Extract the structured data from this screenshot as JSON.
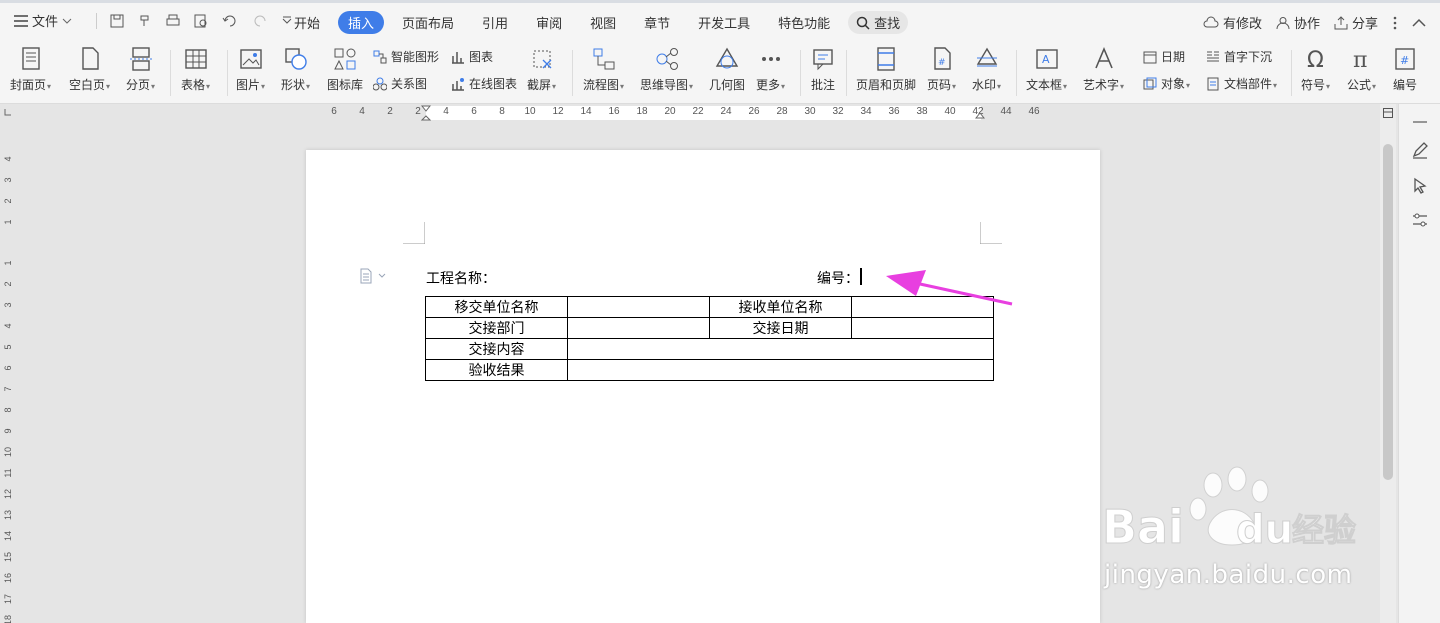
{
  "menubar": {
    "file": "文件",
    "tabs": [
      {
        "label": "开始",
        "active": false
      },
      {
        "label": "插入",
        "active": true
      },
      {
        "label": "页面布局",
        "active": false
      },
      {
        "label": "引用",
        "active": false
      },
      {
        "label": "审阅",
        "active": false
      },
      {
        "label": "视图",
        "active": false
      },
      {
        "label": "章节",
        "active": false
      },
      {
        "label": "开发工具",
        "active": false
      },
      {
        "label": "特色功能",
        "active": false
      }
    ],
    "search": "查找",
    "modified": "有修改",
    "collab": "协作",
    "share": "分享"
  },
  "ribbon": {
    "cover": "封面页",
    "blank": "空白页",
    "pagebreak": "分页",
    "table": "表格",
    "picture": "图片",
    "shape": "形状",
    "iconlib": "图标库",
    "smartart": "智能图形",
    "chart": "图表",
    "relation": "关系图",
    "onlinechart": "在线图表",
    "screenshot": "截屏",
    "flowchart": "流程图",
    "mindmap": "思维导图",
    "geometry": "几何图",
    "more": "更多",
    "comment": "批注",
    "headerfooter": "页眉和页脚",
    "pagenum": "页码",
    "watermark": "水印",
    "textbox": "文本框",
    "wordart": "艺术字",
    "date": "日期",
    "object": "对象",
    "dropcap": "首字下沉",
    "docpart": "文档部件",
    "symbol": "符号",
    "formula": "公式",
    "numbering": "编号"
  },
  "ruler": {
    "h_ticks": [
      "6",
      "4",
      "2",
      "2",
      "4",
      "6",
      "8",
      "10",
      "12",
      "14",
      "16",
      "18",
      "20",
      "22",
      "24",
      "26",
      "28",
      "30",
      "32",
      "34",
      "36",
      "38",
      "40",
      "42",
      "44",
      "46"
    ],
    "v_ticks_top": [
      "4",
      "3",
      "2",
      "1"
    ],
    "v_ticks": [
      "1",
      "2",
      "3",
      "4",
      "5",
      "6",
      "7",
      "8",
      "9",
      "10",
      "11",
      "12",
      "13",
      "14",
      "15",
      "16",
      "17",
      "18"
    ]
  },
  "document": {
    "title_label": "工程名称：",
    "number_label": "编号：",
    "table": {
      "row1": [
        "移交单位名称",
        "",
        "接收单位名称",
        ""
      ],
      "row2": [
        "交接部门",
        "",
        "交接日期",
        ""
      ],
      "row3": [
        "交接内容",
        ""
      ],
      "row4": [
        "验收结果",
        ""
      ]
    }
  },
  "watermark": {
    "brand": "Baidu经验",
    "url": "jingyan.baidu.com"
  },
  "colors": {
    "accent": "#3f7de8",
    "arrow": "#e83fe0"
  }
}
